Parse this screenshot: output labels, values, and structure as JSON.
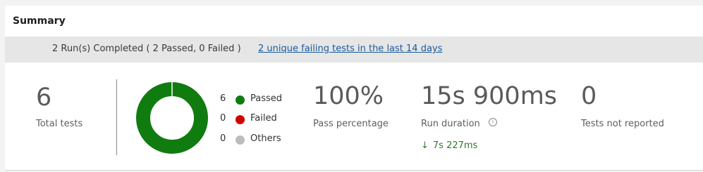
{
  "summary": {
    "title": "Summary",
    "banner_text": "2 Run(s) Completed ( 2 Passed, 0 Failed )",
    "banner_link": "2 unique failing tests in the last 14 days"
  },
  "stats": {
    "total_tests": {
      "value": "6",
      "label": "Total tests"
    },
    "pass_percentage": {
      "value": "100%",
      "label": "Pass percentage"
    },
    "run_duration": {
      "value": "15s 900ms",
      "label": "Run duration",
      "delta": "7s 227ms",
      "delta_direction": "down"
    },
    "not_reported": {
      "value": "0",
      "label": "Tests not reported"
    }
  },
  "chart_data": {
    "type": "pie",
    "style": "donut",
    "categories": [
      "Passed",
      "Failed",
      "Others"
    ],
    "values": [
      6,
      0,
      0
    ],
    "colors": [
      "#107c10",
      "#d30000",
      "#bcbcbc"
    ]
  },
  "legend": [
    {
      "count": "6",
      "label": "Passed"
    },
    {
      "count": "0",
      "label": "Failed"
    },
    {
      "count": "0",
      "label": "Others"
    }
  ]
}
